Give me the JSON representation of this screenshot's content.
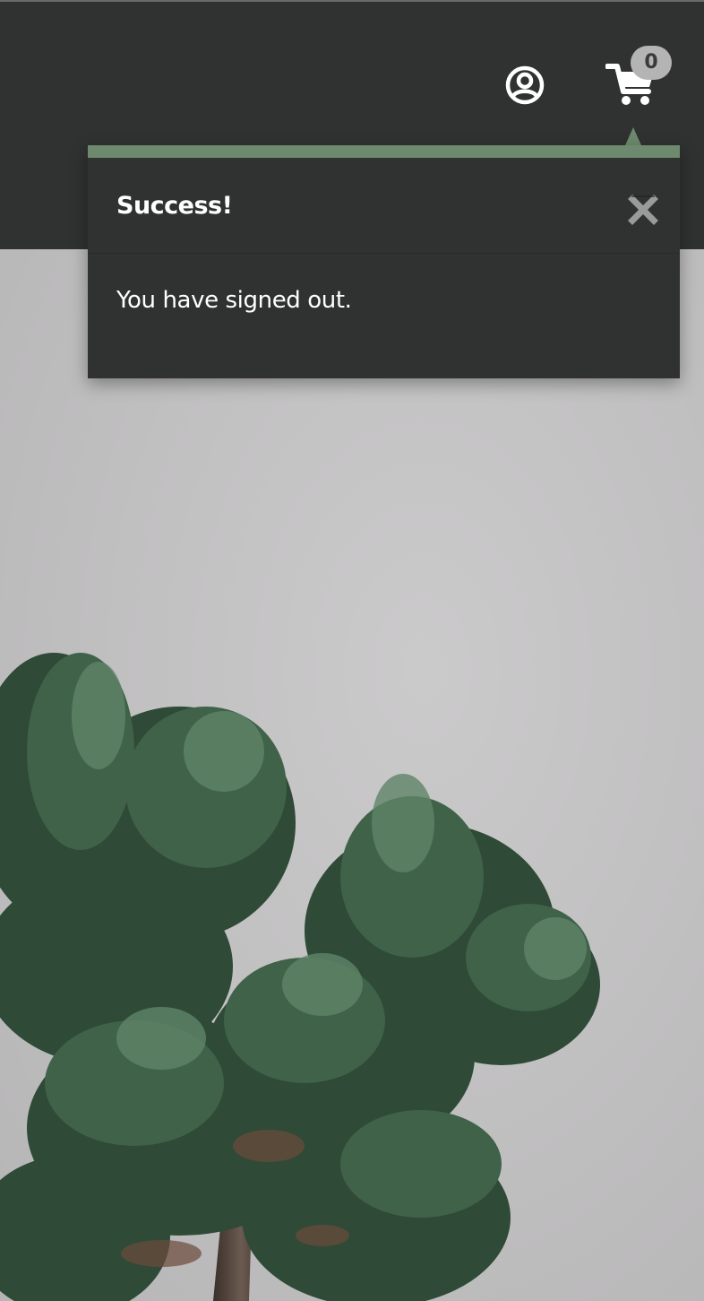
{
  "header": {
    "account_icon": "user-circle-icon",
    "cart_icon": "shopping-cart-icon",
    "cart_count": "0"
  },
  "notification": {
    "title": "Success!",
    "message": "You have signed out.",
    "close_icon": "close-icon",
    "accent_color": "#6e8a6e",
    "background_color": "#303231"
  },
  "hero": {
    "image": "juniper-bonsai-photo"
  }
}
